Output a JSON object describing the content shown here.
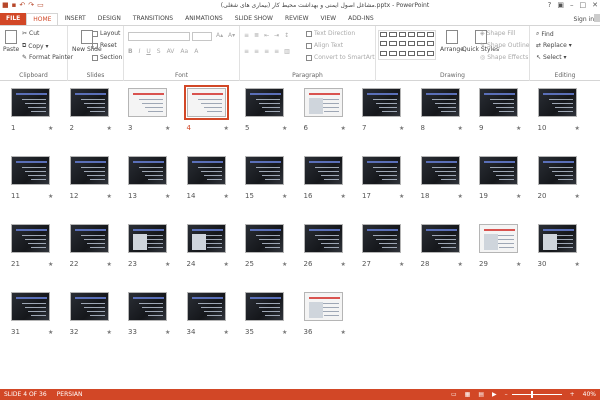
{
  "window": {
    "title": "مشاغل اصول ایمنی و بهداشت محیط کار (بیماری های شغلی).pptx - PowerPoint",
    "sign_in": "Sign in"
  },
  "tabs": [
    "FILE",
    "HOME",
    "INSERT",
    "DESIGN",
    "TRANSITIONS",
    "ANIMATIONS",
    "SLIDE SHOW",
    "REVIEW",
    "VIEW",
    "ADD-INS"
  ],
  "active_tab": "HOME",
  "ribbon": {
    "clipboard": {
      "label": "Clipboard",
      "paste": "Paste",
      "cut": "Cut",
      "copy": "Copy",
      "format_painter": "Format Painter"
    },
    "slides": {
      "label": "Slides",
      "new_slide": "New Slide",
      "layout": "Layout",
      "reset": "Reset",
      "section": "Section"
    },
    "font": {
      "label": "Font"
    },
    "paragraph": {
      "label": "Paragraph",
      "text_direction": "Text Direction",
      "align_text": "Align Text",
      "convert_smartart": "Convert to SmartArt"
    },
    "drawing": {
      "label": "Drawing",
      "arrange": "Arrange",
      "quick_styles": "Quick Styles",
      "shape_fill": "Shape Fill",
      "shape_outline": "Shape Outline",
      "shape_effects": "Shape Effects"
    },
    "editing": {
      "label": "Editing",
      "find": "Find",
      "replace": "Replace",
      "select": "Select"
    }
  },
  "slides": {
    "count": 36,
    "selected": 4,
    "numbers": [
      "1",
      "2",
      "3",
      "4",
      "5",
      "6",
      "7",
      "8",
      "9",
      "10",
      "11",
      "12",
      "13",
      "14",
      "15",
      "16",
      "17",
      "18",
      "19",
      "20",
      "21",
      "22",
      "23",
      "24",
      "25",
      "26",
      "27",
      "28",
      "29",
      "30",
      "31",
      "32",
      "33",
      "34",
      "35",
      "36"
    ],
    "star": "★"
  },
  "status": {
    "slide_info": "SLIDE 4 OF 36",
    "language": "PERSIAN",
    "zoom": "40%",
    "zoom_fraction": 0.4
  },
  "colors": {
    "accent": "#d24726"
  }
}
